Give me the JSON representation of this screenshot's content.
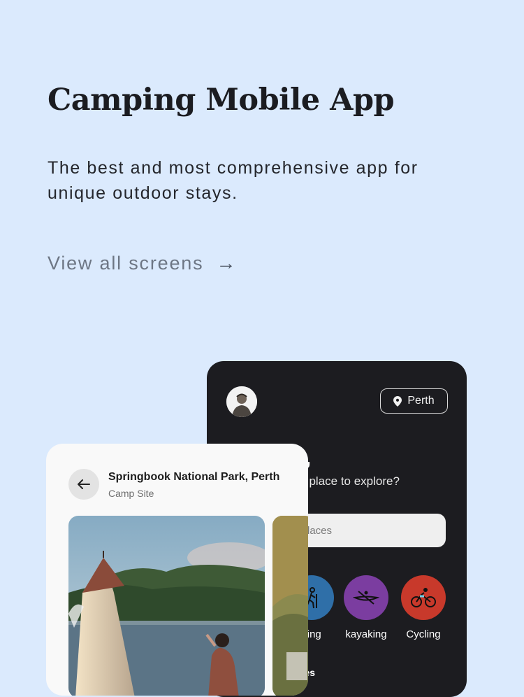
{
  "hero": {
    "title": "Camping Mobile App",
    "subtitle": "The best and most comprehensive app for unique outdoor stays.",
    "link_label": "View all screens",
    "link_arrow": "→"
  },
  "dark_screen": {
    "location_label": "Perth",
    "greeting": "la,",
    "greeting_sub": "ew place to explore?",
    "search_placeholder": "laces",
    "categories": [
      {
        "label": "king",
        "icon": "hiking-icon",
        "color": "#2f6fa8"
      },
      {
        "label": "kayaking",
        "icon": "kayak-icon",
        "color": "#7b3da0"
      },
      {
        "label": "Cycling",
        "icon": "cycling-icon",
        "color": "#c8392b"
      }
    ],
    "section_label": "laces"
  },
  "light_screen": {
    "park_name": "Springbook National Park, Perth",
    "park_type": "Camp Site",
    "back_icon": "arrow-left-icon"
  }
}
